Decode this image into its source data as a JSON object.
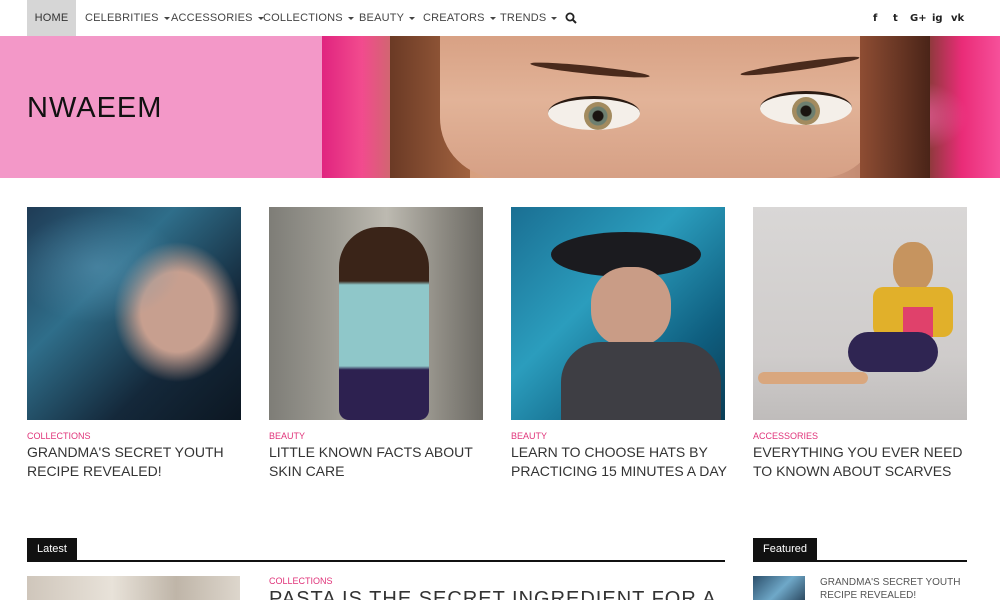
{
  "nav": {
    "home": "HOME",
    "items": [
      "CELEBRITIES",
      "ACCESSORIES",
      "COLLECTIONS",
      "BEAUTY",
      "CREATORS",
      "TRENDS"
    ],
    "social": [
      "f",
      "t",
      "G+",
      "ig",
      "vk"
    ]
  },
  "hero": {
    "brand": "NWAEEM"
  },
  "cards": [
    {
      "category": "COLLECTIONS",
      "title": "GRANDMA'S SECRET YOUTH RECIPE REVEALED!"
    },
    {
      "category": "BEAUTY",
      "title": "LITTLE KNOWN FACTS ABOUT SKIN CARE"
    },
    {
      "category": "BEAUTY",
      "title": "LEARN TO CHOOSE HATS BY PRACTICING 15 MINUTES A DAY"
    },
    {
      "category": "ACCESSORIES",
      "title": "EVERYTHING YOU EVER NEED TO KNOWN ABOUT SCARVES"
    }
  ],
  "sections": {
    "latest": "Latest",
    "featured": "Featured"
  },
  "latest": {
    "category": "COLLECTIONS",
    "title": "PASTA IS THE SECRET INGREDIENT FOR A"
  },
  "featured": {
    "title": "GRANDMA'S SECRET YOUTH RECIPE REVEALED!"
  },
  "colors": {
    "accent": "#e0347a",
    "hero_bg": "#f398c8",
    "dark": "#111111"
  }
}
